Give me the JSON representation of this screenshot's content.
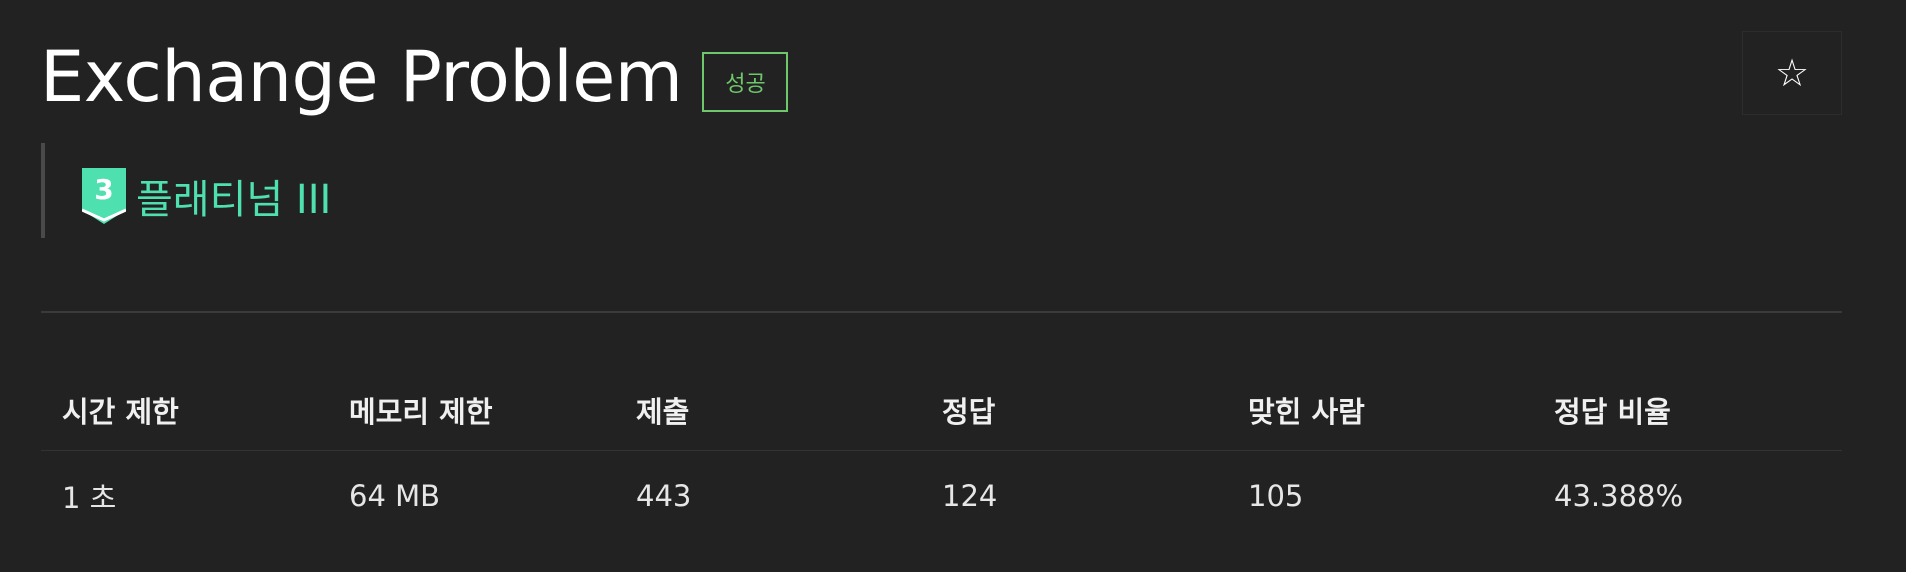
{
  "problem": {
    "title": "Exchange Problem",
    "status_badge": "성공",
    "tier": {
      "icon_name": "tier-platinum-3-icon",
      "number": "3",
      "label": "플래티넘 III",
      "color": "#4fe0b0"
    }
  },
  "star_icon": "☆",
  "colors": {
    "background": "#222222",
    "success": "#6fc76b",
    "platinum": "#4fe0b0"
  },
  "info_table": {
    "headers": [
      "시간 제한",
      "메모리 제한",
      "제출",
      "정답",
      "맞힌 사람",
      "정답 비율"
    ],
    "values": [
      "1 초",
      "64 MB",
      "443",
      "124",
      "105",
      "43.388%"
    ]
  }
}
